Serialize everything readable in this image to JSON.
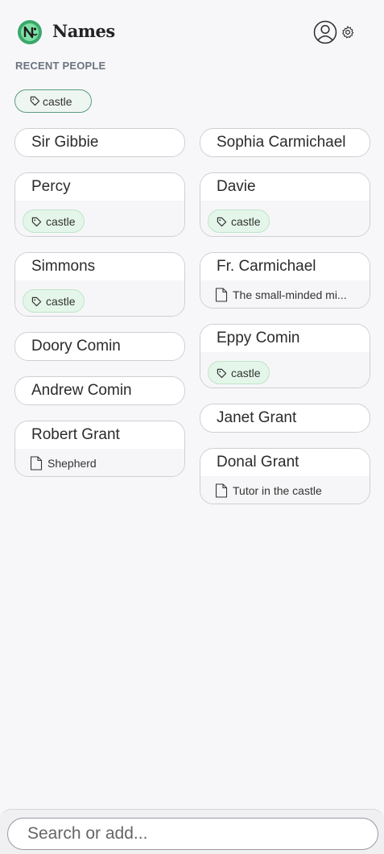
{
  "app": {
    "title": "Names"
  },
  "header": {
    "user_icon": "user-circle-icon",
    "settings_icon": "gear-icon"
  },
  "section": {
    "title": "RECENT PEOPLE"
  },
  "filter": {
    "tag_label": "castle",
    "icon": "tag-icon"
  },
  "columns": {
    "left": [
      {
        "name": "Sir Gibbie"
      },
      {
        "name": "Percy",
        "tag": "castle"
      },
      {
        "name": "Simmons",
        "tag": "castle"
      },
      {
        "name": "Doory Comin"
      },
      {
        "name": "Andrew Comin"
      },
      {
        "name": "Robert Grant",
        "note": "Shepherd"
      }
    ],
    "right": [
      {
        "name": "Sophia Carmichael"
      },
      {
        "name": "Davie",
        "tag": "castle"
      },
      {
        "name": "Fr. Carmichael",
        "note": "The small-minded mi..."
      },
      {
        "name": "Eppy Comin",
        "tag": "castle"
      },
      {
        "name": "Janet Grant"
      },
      {
        "name": "Donal Grant",
        "note": "Tutor in the castle"
      }
    ]
  },
  "search": {
    "placeholder": "Search or add..."
  },
  "colors": {
    "accent": "#5e9c80",
    "tag_bg": "#e4f6e9",
    "logo_green": "#3aa86b"
  }
}
